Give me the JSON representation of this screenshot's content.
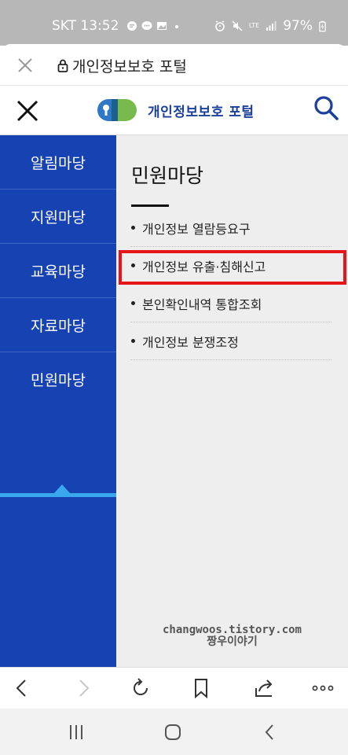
{
  "status_bar": {
    "carrier_time": "SKT 13:52",
    "battery": "97%",
    "network": "LTE",
    "icons_left": [
      "chat-icon",
      "message-icon",
      "gallery-icon",
      "dot-icon"
    ],
    "icons_right": [
      "alarm-icon",
      "mute-icon",
      "lte-icon",
      "signal-icon",
      "battery-icon"
    ]
  },
  "browser": {
    "page_title": "개인정보보호 포털"
  },
  "site": {
    "logo_text": "개인정보보호 포털",
    "brand_color": "#1742b2"
  },
  "sidebar": {
    "items": [
      {
        "label": "알림마당",
        "active": false
      },
      {
        "label": "지원마당",
        "active": false
      },
      {
        "label": "교육마당",
        "active": false
      },
      {
        "label": "자료마당",
        "active": false
      },
      {
        "label": "민원마당",
        "active": true
      }
    ]
  },
  "content": {
    "section_title": "민원마당",
    "menu": [
      {
        "label": "개인정보 열람등요구",
        "highlighted": false
      },
      {
        "label": "개인정보 유출·침해신고",
        "highlighted": true
      },
      {
        "label": "본인확인내역 통합조회",
        "highlighted": false
      },
      {
        "label": "개인정보 분쟁조정",
        "highlighted": false
      }
    ],
    "watermark_line1": "changwoos.tistory.com",
    "watermark_line2": "짱우이야기",
    "highlight_color": "#e8141c"
  },
  "toolbar": {
    "icons": [
      "back-icon",
      "forward-icon",
      "reload-icon",
      "bookmark-icon",
      "share-icon",
      "more-icon"
    ]
  },
  "navbar": {
    "icons": [
      "recents-icon",
      "home-icon",
      "system-back-icon"
    ]
  }
}
